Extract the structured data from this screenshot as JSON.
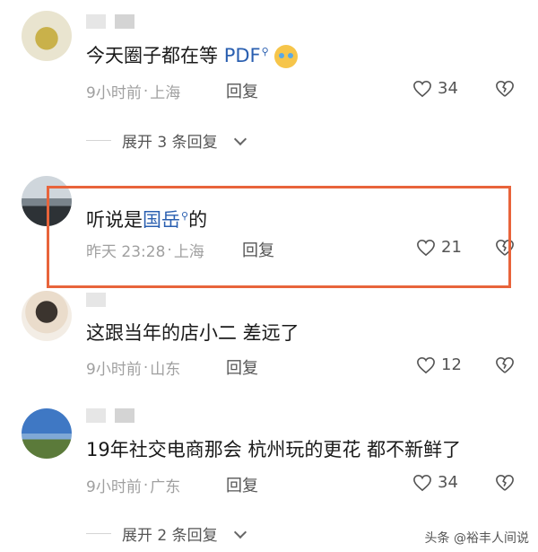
{
  "comments": [
    {
      "text_pre": "今天圈子都在等 ",
      "link": "PDF",
      "time": "9小时前",
      "location": "上海",
      "reply": "回复",
      "likes": "34",
      "expand": "展开 3 条回复"
    },
    {
      "text_pre": "听说是",
      "link": "国岳",
      "text_post": "的",
      "time": "昨天 23:28",
      "location": "上海",
      "reply": "回复",
      "likes": "21"
    },
    {
      "text_pre": "这跟当年的店小二 差远了",
      "time": "9小时前",
      "location": "山东",
      "reply": "回复",
      "likes": "12"
    },
    {
      "text_pre": "19年社交电商那会 杭州玩的更花 都不新鲜了",
      "time": "9小时前",
      "location": "广东",
      "reply": "回复",
      "likes": "34",
      "expand": "展开 2 条回复"
    }
  ],
  "sep": "·",
  "watermark": "头条 @裕丰人间说",
  "colors": {
    "highlight": "#e8643b",
    "link": "#2a5fb0"
  }
}
